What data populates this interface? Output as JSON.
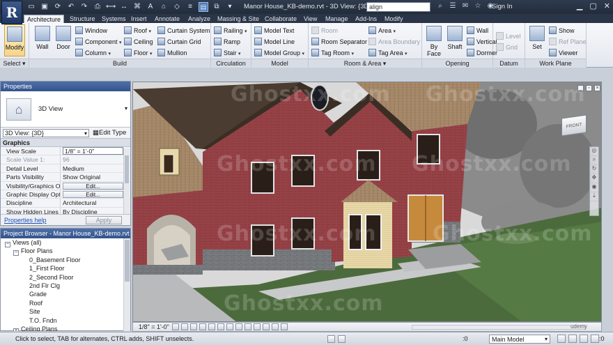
{
  "titlebar": {
    "app_logo": "R",
    "title": "Manor House_KB-demo.rvt - 3D View: {3D}",
    "search_value": "align",
    "signin": "Sign In"
  },
  "ribbon_tabs": [
    "Architecture",
    "Structure",
    "Systems",
    "Insert",
    "Annotate",
    "Analyze",
    "Massing & Site",
    "Collaborate",
    "View",
    "Manage",
    "Add-Ins",
    "Modify"
  ],
  "ribbon": {
    "select": {
      "modify": "Modify",
      "label": "Select ▾"
    },
    "build": {
      "wall": "Wall",
      "door": "Door",
      "window": "Window",
      "component": "Component",
      "column": "Column",
      "roof": "Roof",
      "ceiling": "Ceiling",
      "floor": "Floor",
      "curtain_system": "Curtain System",
      "curtain_grid": "Curtain Grid",
      "mullion": "Mullion",
      "label": "Build"
    },
    "circulation": {
      "railing": "Railing",
      "ramp": "Ramp",
      "stair": "Stair",
      "label": "Circulation"
    },
    "model": {
      "text": "Model Text",
      "line": "Model Line",
      "group": "Model Group",
      "label": "Model"
    },
    "room_area": {
      "room": "Room",
      "room_separator": "Room Separator",
      "tag_room": "Tag Room",
      "area": "Area",
      "area_boundary": "Area Boundary",
      "tag_area": "Tag Area",
      "label": "Room & Area ▾"
    },
    "opening": {
      "by_face": "By Face",
      "shaft": "Shaft",
      "wall": "Wall",
      "vertical": "Vertical",
      "dormer": "Dormer",
      "label": "Opening"
    },
    "datum": {
      "level": "Level",
      "grid": "Grid",
      "label": "Datum"
    },
    "work_plane": {
      "set": "Set",
      "show": "Show",
      "ref_plane": "Ref Plane",
      "viewer": "Viewer",
      "label": "Work Plane"
    }
  },
  "properties": {
    "title": "Properties",
    "type_name": "3D View",
    "view_selector": "3D View: {3D}",
    "edit_type": "Edit Type",
    "group": "Graphics",
    "rows": [
      {
        "k": "View Scale",
        "v": "1/8\" = 1'-0\""
      },
      {
        "k": "Scale Value    1:",
        "v": "96"
      },
      {
        "k": "Detail Level",
        "v": "Medium"
      },
      {
        "k": "Parts Visibility",
        "v": "Show Original"
      },
      {
        "k": "Visibility/Graphics O...",
        "v": "Edit..."
      },
      {
        "k": "Graphic Display Opti...",
        "v": "Edit..."
      },
      {
        "k": "Discipline",
        "v": "Architectural"
      },
      {
        "k": "Show Hidden Lines",
        "v": "By Discipline"
      }
    ],
    "help": "Properties help",
    "apply": "Apply"
  },
  "browser": {
    "title": "Project Browser - Manor House_KB-demo.rvt",
    "items": [
      {
        "label": "Views (all)",
        "indent": 0,
        "toggle": "−"
      },
      {
        "label": "Floor Plans",
        "indent": 1,
        "toggle": "−"
      },
      {
        "label": "0_Basement Floor",
        "indent": 2,
        "toggle": ""
      },
      {
        "label": "1_First Floor",
        "indent": 2,
        "toggle": ""
      },
      {
        "label": "2_Second Floor",
        "indent": 2,
        "toggle": ""
      },
      {
        "label": "2nd Flr Clg",
        "indent": 2,
        "toggle": ""
      },
      {
        "label": "Grade",
        "indent": 2,
        "toggle": ""
      },
      {
        "label": "Roof",
        "indent": 2,
        "toggle": ""
      },
      {
        "label": "Site",
        "indent": 2,
        "toggle": ""
      },
      {
        "label": "T.O. Fndn",
        "indent": 2,
        "toggle": ""
      },
      {
        "label": "Ceiling Plans",
        "indent": 1,
        "toggle": "+"
      }
    ]
  },
  "viewport": {
    "viewcube_label": "FRONT"
  },
  "viewbar": {
    "scale": "1/8\" = 1'-0\"",
    "udemy": "udemy"
  },
  "statusbar": {
    "hint": "Click to select, TAB for alternates, CTRL adds, SHIFT unselects.",
    "zero": ":0",
    "model": "Main Model",
    "filter": ":0"
  },
  "watermark": "Ghostxx.com"
}
